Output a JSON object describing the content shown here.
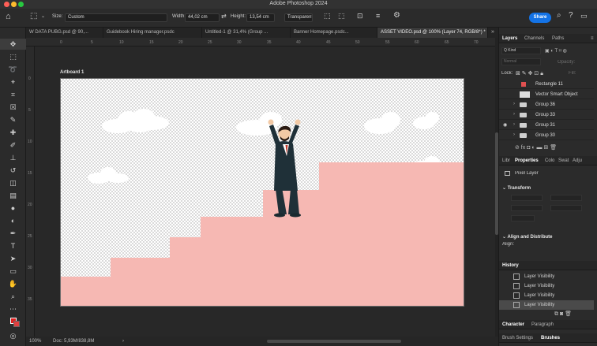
{
  "app": {
    "title": "Adobe Photoshop 2024"
  },
  "colors": {
    "accent": "#1473e6",
    "canvas_pink": "#f6b8b3",
    "suit": "#1f3038",
    "folder_red": "#e05050"
  },
  "options_bar": {
    "size_label": "Size:",
    "size_value": "Custom",
    "width_label": "Width:",
    "width_value": "44,02 cm",
    "height_label": "Height:",
    "height_value": "13,54 cm",
    "background_value": "Transparent",
    "share_label": "Share"
  },
  "tabs": [
    {
      "label": "W DATA PUBG.psd @ 90,..."
    },
    {
      "label": "Guidebook Hiring manager.psdc"
    },
    {
      "label": "Untitled-1 @ 31,4% (Group ..."
    },
    {
      "label": "Banner Homepage.psdc..."
    },
    {
      "label": "ASSET VIDEO.psd @ 100% (Layer 74, RGB/8*) *"
    }
  ],
  "ruler": {
    "h_ticks": [
      "0",
      "5",
      "10",
      "15",
      "20",
      "25",
      "30",
      "35",
      "40",
      "45",
      "50",
      "55",
      "60",
      "65",
      "70"
    ],
    "v_ticks": [
      "0",
      "5",
      "10",
      "15",
      "20",
      "25",
      "30",
      "35"
    ]
  },
  "canvas": {
    "artboard_label": "Artboard 1"
  },
  "status": {
    "zoom": "100%",
    "doc": "Doc: 5,93M/838,8M"
  },
  "layers_panel": {
    "tabs": [
      "Layers",
      "Channels",
      "Paths"
    ],
    "filter_kind": "Q Kind",
    "blend_mode": "Normal",
    "opacity_label": "Opacity:",
    "lock_label": "Lock:",
    "fill_label": "Fill:",
    "layers": [
      {
        "name": "Rectangle 11"
      },
      {
        "name": "Vector Smart Object"
      },
      {
        "name": "Group 36"
      },
      {
        "name": "Group 33"
      },
      {
        "name": "Group 31"
      },
      {
        "name": "Group 30"
      }
    ]
  },
  "properties_panel": {
    "tabs": [
      "Libr",
      "Properties",
      "Colo",
      "Swat",
      "Adju"
    ],
    "kind": "Pixel Layer",
    "transform_title": "Transform",
    "align_title": "Align and Distribute",
    "align_label": "Align:"
  },
  "history_panel": {
    "title": "History",
    "items": [
      "Layer Visibility",
      "Layer Visibility",
      "Layer Visibility",
      "Layer Visibility"
    ]
  },
  "character_panel": {
    "tabs": [
      "Character",
      "Paragraph"
    ]
  },
  "brush_panel": {
    "tabs": [
      "Brush Settings",
      "Brushes"
    ]
  }
}
